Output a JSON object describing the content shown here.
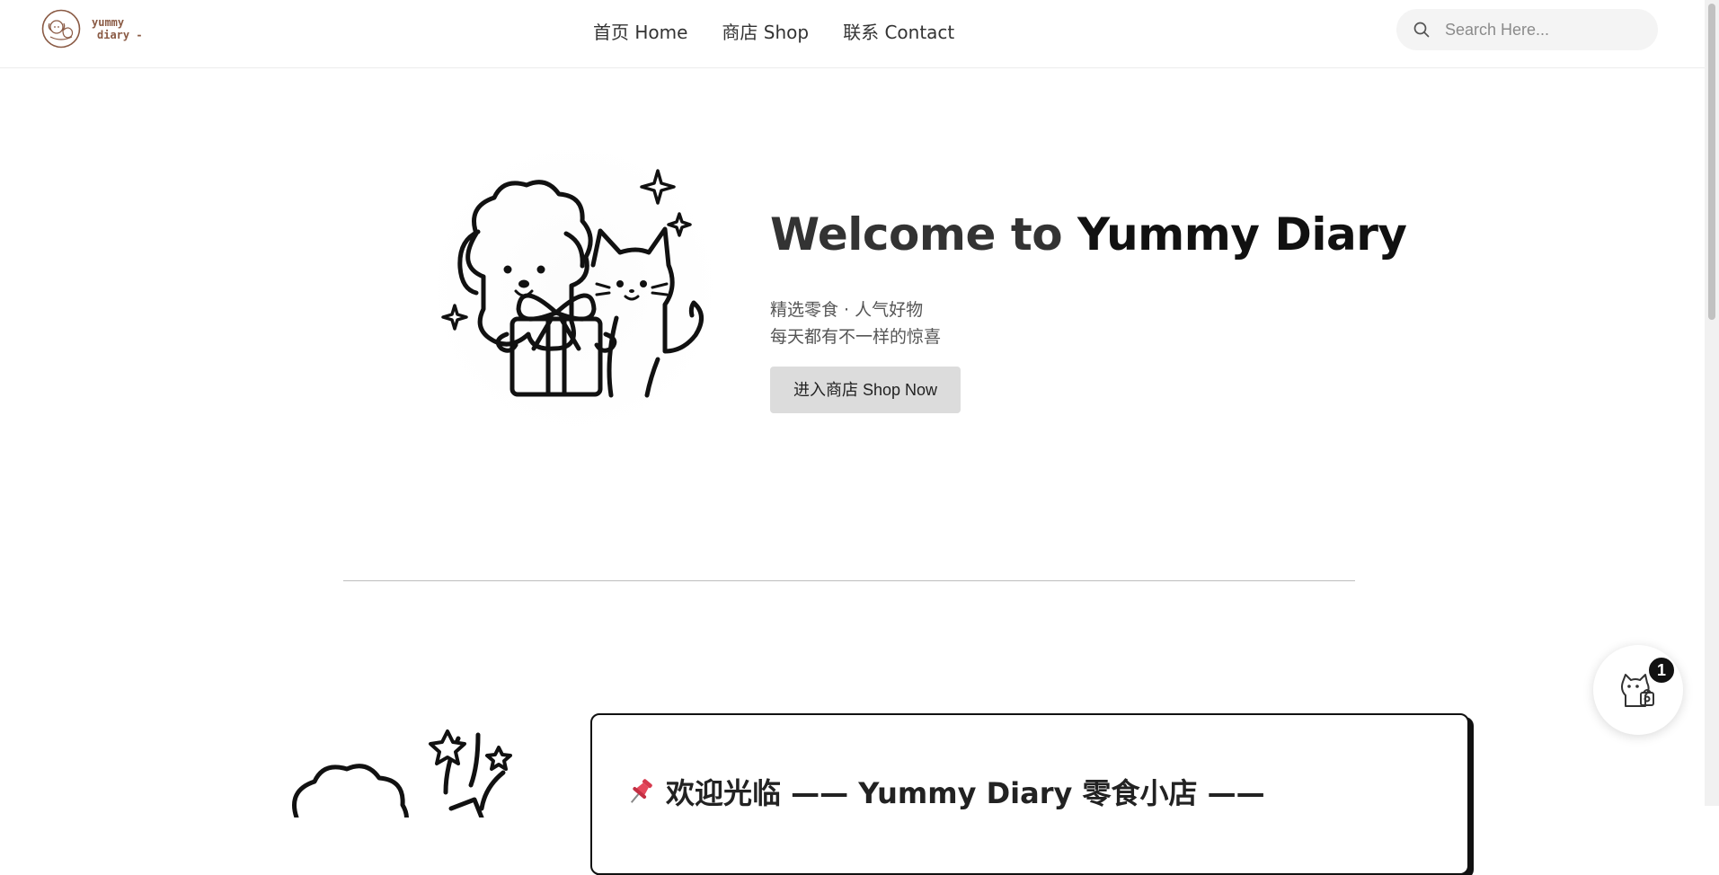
{
  "header": {
    "logo_line1": "yummy",
    "logo_line2": "diary -",
    "nav": [
      {
        "label": "首页 Home"
      },
      {
        "label": "商店 Shop"
      },
      {
        "label": "联系 Contact"
      }
    ],
    "search_placeholder": "Search Here..."
  },
  "hero": {
    "title_prefix": "Welcome to ",
    "title_brand": "Yummy Diary",
    "subtitle_line1": "精选零食 · 人气好物",
    "subtitle_line2": "每天都有不一样的惊喜",
    "cta_label": "进入商店 Shop Now"
  },
  "section2": {
    "title": "欢迎光临 —— Yummy Diary 零食小店 ——"
  },
  "cart": {
    "badge_count": "1"
  },
  "icons": {
    "search": "search-icon",
    "pin": "pushpin-icon",
    "cart": "cat-shopping-bag-icon"
  },
  "colors": {
    "brand_brown": "#8a5a44",
    "button_bg": "#dcdcdc",
    "badge_bg": "#111111",
    "pin_red": "#d63a4e"
  }
}
